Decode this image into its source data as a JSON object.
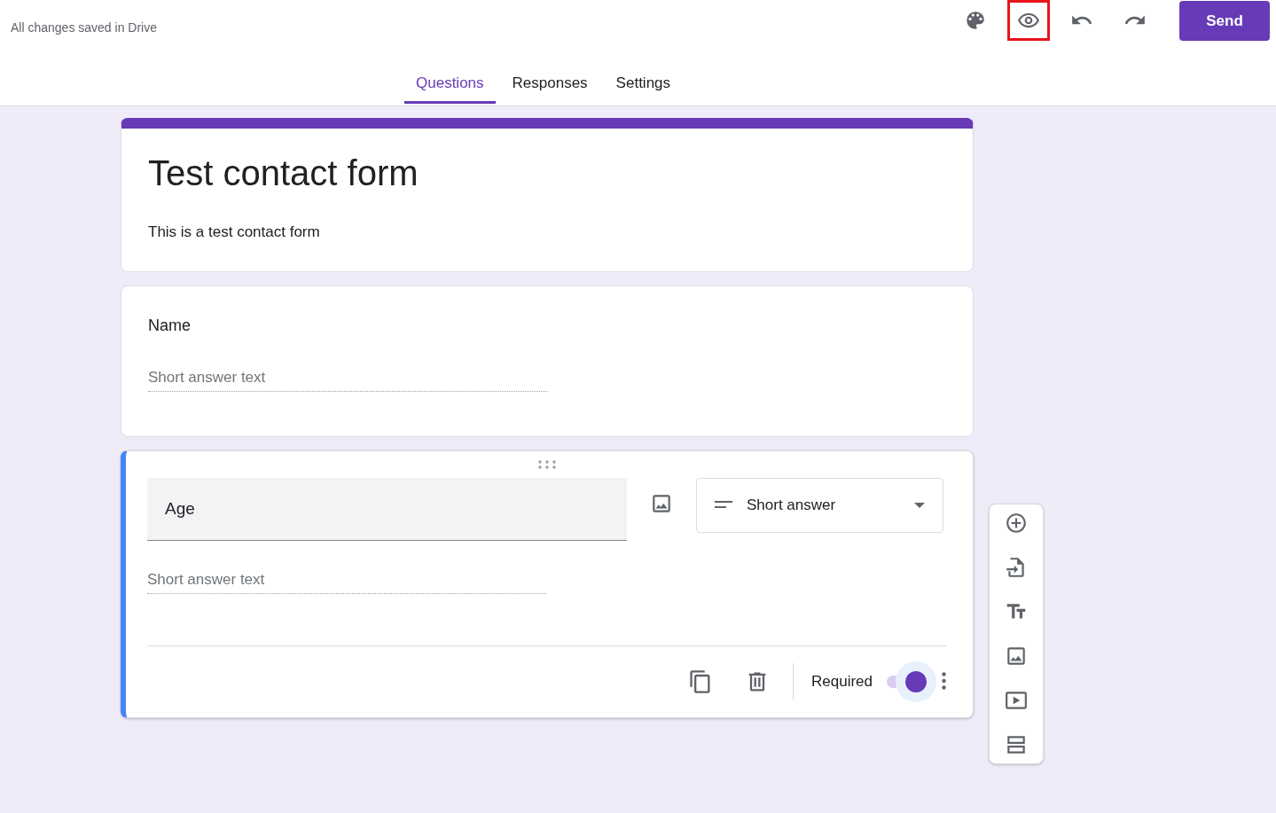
{
  "header": {
    "save_status": "All changes saved in Drive",
    "toolbar": [
      {
        "kind": "palette",
        "highlighted": false
      },
      {
        "kind": "preview",
        "highlighted": true
      },
      {
        "kind": "undo",
        "highlighted": false
      },
      {
        "kind": "redo",
        "highlighted": false
      }
    ],
    "send_button": "Send"
  },
  "tabs": [
    {
      "label": "Questions",
      "selected": true
    },
    {
      "label": "Responses",
      "selected": false
    },
    {
      "label": "Settings",
      "selected": false
    }
  ],
  "form": {
    "title": "Test contact form",
    "description": "This is a test contact form"
  },
  "questions": [
    {
      "title": "Name",
      "placeholder": "Short answer text",
      "active": false
    },
    {
      "title": "Age",
      "placeholder": "Short answer text",
      "active": true,
      "type": "Short answer",
      "required_label": "Required",
      "required": true
    }
  ],
  "side_toolbar": [
    {
      "kind": "add"
    },
    {
      "kind": "import"
    },
    {
      "kind": "title"
    },
    {
      "kind": "image"
    },
    {
      "kind": "video"
    },
    {
      "kind": "section"
    }
  ]
}
